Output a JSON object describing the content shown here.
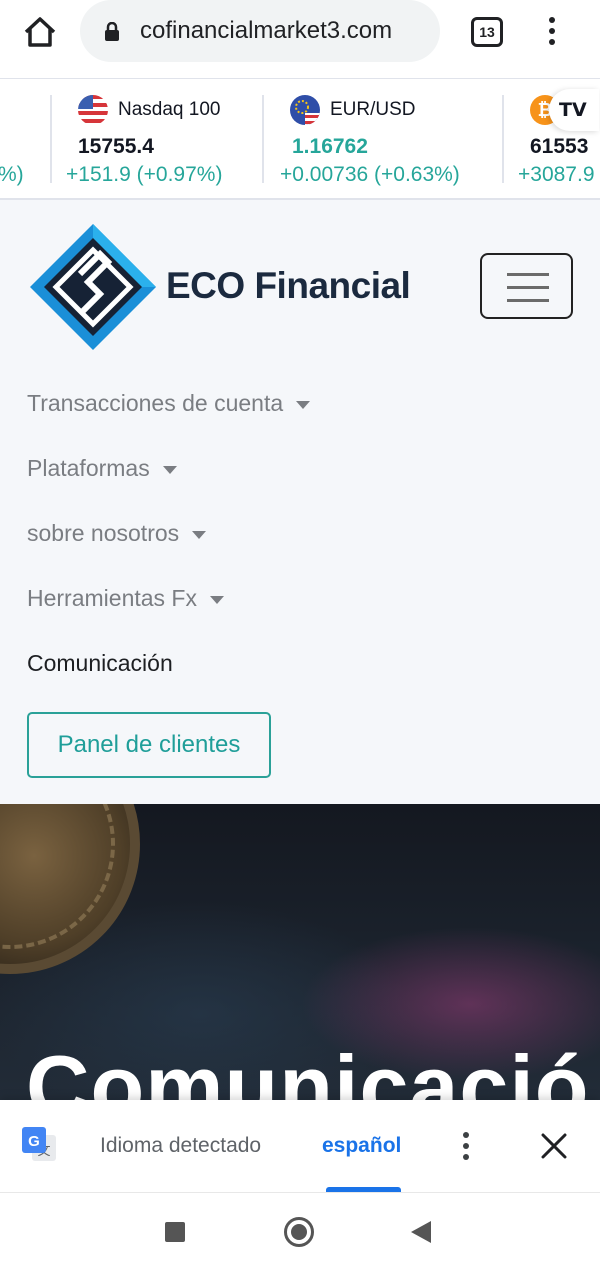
{
  "browser": {
    "url": "cofinancialmarket3.com",
    "tab_count": "13"
  },
  "ticker": {
    "left_partial_change": "%)",
    "items": [
      {
        "name": "Nasdaq 100",
        "flag": "us-flag-icon",
        "price": "15755.4",
        "change": "+151.9 (+0.97%)",
        "price_color": "#131722"
      },
      {
        "name": "EUR/USD",
        "flag": "eu-us-flag-icon",
        "price": "1.16762",
        "change": "+0.00736 (+0.63%)",
        "price_color": "#26a69a"
      },
      {
        "name": "",
        "flag": "bitcoin-icon",
        "price": "61553",
        "change": "+3087.9",
        "price_color": "#131722"
      }
    ],
    "badge": "TV"
  },
  "site": {
    "logo_text": "ECO Financial",
    "nav": [
      {
        "label": "Transacciones de cuenta",
        "has_dropdown": true
      },
      {
        "label": "Plataformas",
        "has_dropdown": true
      },
      {
        "label": "sobre nosotros",
        "has_dropdown": true
      },
      {
        "label": "Herramientas Fx",
        "has_dropdown": true
      },
      {
        "label": "Comunicación",
        "has_dropdown": false
      }
    ],
    "panel_button": "Panel de clientes"
  },
  "hero": {
    "title": "Comunicació"
  },
  "translate_bar": {
    "detected_label": "Idioma detectado",
    "language": "español"
  },
  "colors": {
    "accent_teal": "#26a69a",
    "translate_blue": "#1a73e8",
    "logo_dark": "#1b2a3f"
  }
}
